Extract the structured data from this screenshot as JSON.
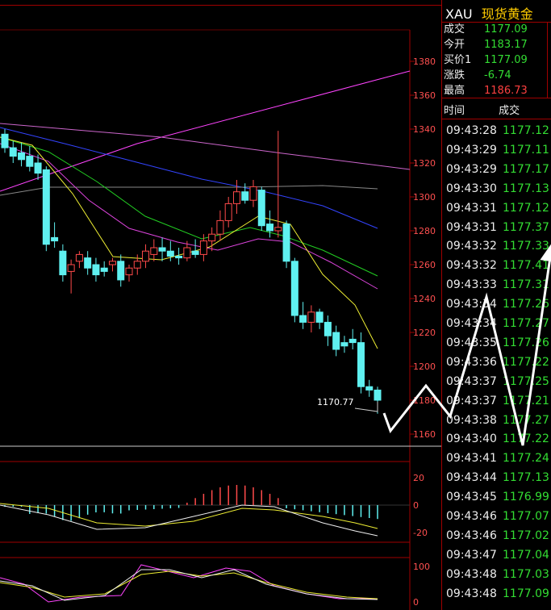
{
  "chart_data": {
    "type": "candlestick",
    "y_axis_ticks": [
      "1380",
      "1360",
      "1340",
      "1320",
      "1300",
      "1280",
      "1260",
      "1240",
      "1220",
      "1200",
      "1180",
      "1160"
    ],
    "ylim": [
      1152,
      1392
    ],
    "last_price_label": "1170.77",
    "macd_ticks": [
      "20",
      "0",
      "-20"
    ],
    "kdj_ticks": [
      "100",
      "0"
    ],
    "candles": [
      {
        "o": 1337,
        "h": 1340,
        "l": 1326,
        "c": 1329
      },
      {
        "o": 1329,
        "h": 1333,
        "l": 1320,
        "c": 1324
      },
      {
        "o": 1326,
        "h": 1332,
        "l": 1318,
        "c": 1322
      },
      {
        "o": 1324,
        "h": 1330,
        "l": 1315,
        "c": 1318
      },
      {
        "o": 1320,
        "h": 1325,
        "l": 1310,
        "c": 1314
      },
      {
        "o": 1316,
        "h": 1318,
        "l": 1268,
        "c": 1272
      },
      {
        "o": 1276,
        "h": 1285,
        "l": 1270,
        "c": 1274
      },
      {
        "o": 1268,
        "h": 1272,
        "l": 1250,
        "c": 1254
      },
      {
        "o": 1256,
        "h": 1263,
        "l": 1243,
        "c": 1260
      },
      {
        "o": 1262,
        "h": 1268,
        "l": 1258,
        "c": 1266
      },
      {
        "o": 1264,
        "h": 1268,
        "l": 1254,
        "c": 1258
      },
      {
        "o": 1260,
        "h": 1264,
        "l": 1250,
        "c": 1254
      },
      {
        "o": 1258,
        "h": 1262,
        "l": 1253,
        "c": 1256
      },
      {
        "o": 1260,
        "h": 1264,
        "l": 1256,
        "c": 1262
      },
      {
        "o": 1262,
        "h": 1266,
        "l": 1247,
        "c": 1251
      },
      {
        "o": 1254,
        "h": 1260,
        "l": 1250,
        "c": 1258
      },
      {
        "o": 1258,
        "h": 1266,
        "l": 1254,
        "c": 1262
      },
      {
        "o": 1262,
        "h": 1272,
        "l": 1258,
        "c": 1268
      },
      {
        "o": 1266,
        "h": 1275,
        "l": 1262,
        "c": 1270
      },
      {
        "o": 1270,
        "h": 1276,
        "l": 1262,
        "c": 1268
      },
      {
        "o": 1268,
        "h": 1274,
        "l": 1262,
        "c": 1265
      },
      {
        "o": 1265,
        "h": 1270,
        "l": 1260,
        "c": 1264
      },
      {
        "o": 1264,
        "h": 1274,
        "l": 1262,
        "c": 1270
      },
      {
        "o": 1268,
        "h": 1275,
        "l": 1264,
        "c": 1266
      },
      {
        "o": 1266,
        "h": 1278,
        "l": 1262,
        "c": 1274
      },
      {
        "o": 1274,
        "h": 1282,
        "l": 1268,
        "c": 1278
      },
      {
        "o": 1278,
        "h": 1292,
        "l": 1274,
        "c": 1286
      },
      {
        "o": 1286,
        "h": 1300,
        "l": 1282,
        "c": 1296
      },
      {
        "o": 1296,
        "h": 1310,
        "l": 1290,
        "c": 1303
      },
      {
        "o": 1303,
        "h": 1308,
        "l": 1296,
        "c": 1298
      },
      {
        "o": 1298,
        "h": 1310,
        "l": 1294,
        "c": 1306
      },
      {
        "o": 1304,
        "h": 1306,
        "l": 1280,
        "c": 1283
      },
      {
        "o": 1284,
        "h": 1292,
        "l": 1276,
        "c": 1280
      },
      {
        "o": 1280,
        "h": 1339,
        "l": 1276,
        "c": 1282
      },
      {
        "o": 1284,
        "h": 1286,
        "l": 1258,
        "c": 1262
      },
      {
        "o": 1262,
        "h": 1264,
        "l": 1226,
        "c": 1230
      },
      {
        "o": 1230,
        "h": 1238,
        "l": 1222,
        "c": 1226
      },
      {
        "o": 1226,
        "h": 1236,
        "l": 1220,
        "c": 1232
      },
      {
        "o": 1232,
        "h": 1234,
        "l": 1222,
        "c": 1226
      },
      {
        "o": 1226,
        "h": 1230,
        "l": 1212,
        "c": 1218
      },
      {
        "o": 1220,
        "h": 1224,
        "l": 1206,
        "c": 1210
      },
      {
        "o": 1214,
        "h": 1218,
        "l": 1208,
        "c": 1212
      },
      {
        "o": 1216,
        "h": 1222,
        "l": 1210,
        "c": 1214
      },
      {
        "o": 1214,
        "h": 1220,
        "l": 1184,
        "c": 1188
      },
      {
        "o": 1188,
        "h": 1192,
        "l": 1182,
        "c": 1186
      },
      {
        "o": 1186,
        "h": 1188,
        "l": 1172,
        "c": 1180
      }
    ]
  },
  "right_panel": {
    "symbol": "XAU",
    "name": "现货黄金",
    "quote": [
      {
        "label": "成交",
        "value": "1177.09",
        "color": "#33dd33"
      },
      {
        "label": "今开",
        "value": "1183.17",
        "color": "#33dd33"
      },
      {
        "label": "买价1",
        "value": "1177.09",
        "color": "#33dd33"
      },
      {
        "label": "涨跌",
        "value": "-6.74",
        "color": "#33dd33"
      },
      {
        "label": "最高",
        "value": "1186.73",
        "color": "#ff4040"
      }
    ],
    "tick_header": {
      "time": "时间",
      "price": "成交"
    },
    "ticks": [
      {
        "time": "09:43:28",
        "price": "1177.12"
      },
      {
        "time": "09:43:29",
        "price": "1177.11"
      },
      {
        "time": "09:43:29",
        "price": "1177.17"
      },
      {
        "time": "09:43:30",
        "price": "1177.13"
      },
      {
        "time": "09:43:31",
        "price": "1177.12"
      },
      {
        "time": "09:43:31",
        "price": "1177.37"
      },
      {
        "time": "09:43:32",
        "price": "1177.33"
      },
      {
        "time": "09:43:32",
        "price": "1177.41"
      },
      {
        "time": "09:43:33",
        "price": "1177.31"
      },
      {
        "time": "09:43:34",
        "price": "1177.26"
      },
      {
        "time": "09:43:34",
        "price": "1177.27"
      },
      {
        "time": "09:43:35",
        "price": "1177.26"
      },
      {
        "time": "09:43:36",
        "price": "1177.22"
      },
      {
        "time": "09:43:37",
        "price": "1177.25"
      },
      {
        "time": "09:43:37",
        "price": "1177.21"
      },
      {
        "time": "09:43:38",
        "price": "1177.27"
      },
      {
        "time": "09:43:40",
        "price": "1177.22"
      },
      {
        "time": "09:43:41",
        "price": "1177.24"
      },
      {
        "time": "09:43:44",
        "price": "1177.13"
      },
      {
        "time": "09:43:45",
        "price": "1176.99"
      },
      {
        "time": "09:43:46",
        "price": "1177.07"
      },
      {
        "time": "09:43:46",
        "price": "1177.02"
      },
      {
        "time": "09:43:47",
        "price": "1177.04"
      },
      {
        "time": "09:43:48",
        "price": "1177.03"
      },
      {
        "time": "09:43:48",
        "price": "1177.09"
      }
    ]
  }
}
